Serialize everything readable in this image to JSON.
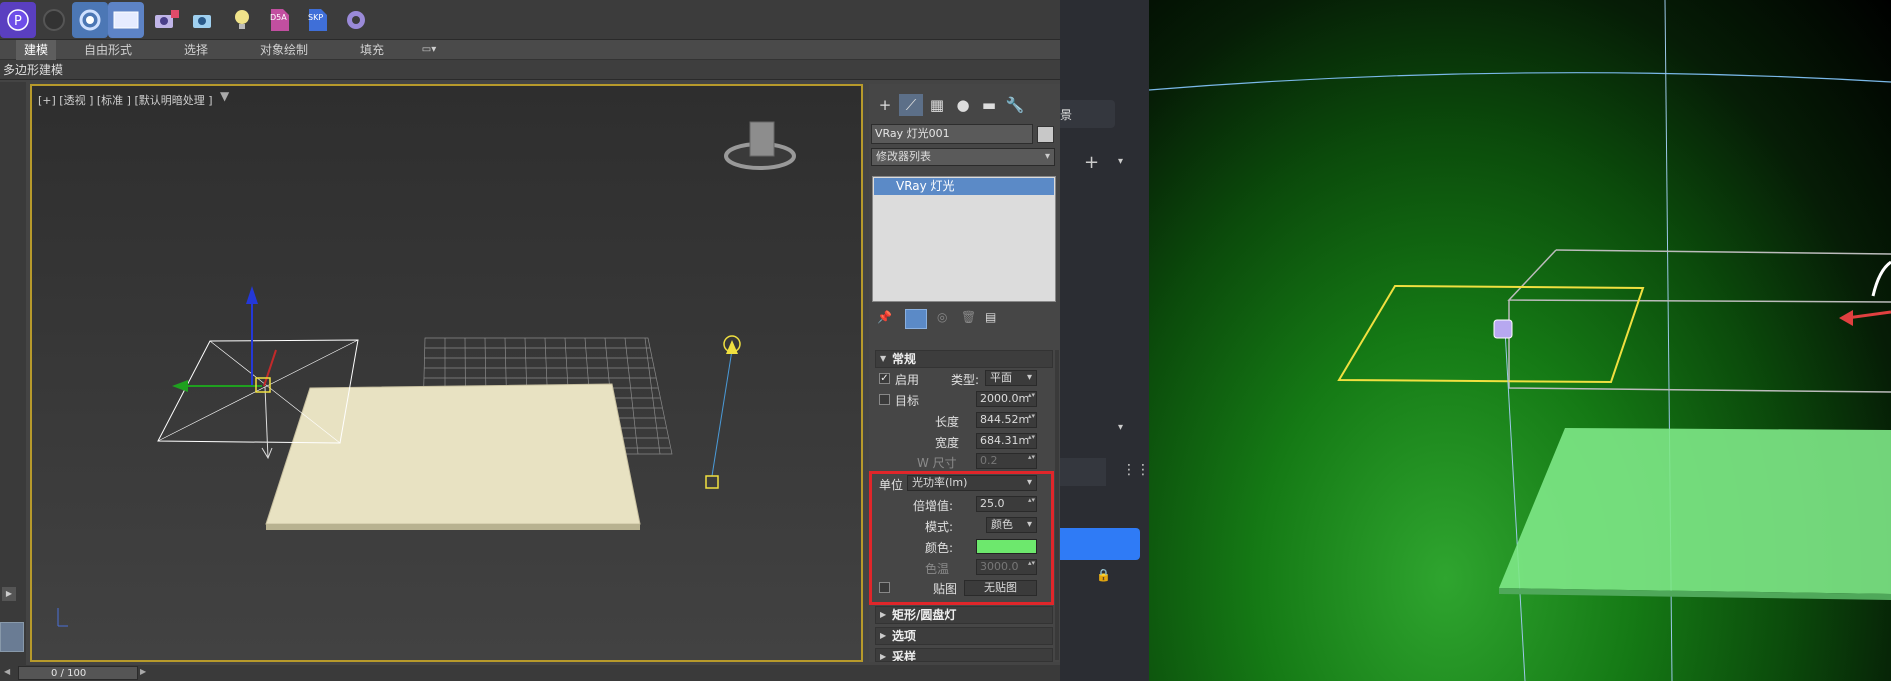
{
  "toolbar": {
    "icons": [
      "p-logo-icon",
      "dark-sphere-icon",
      "c-circle-icon",
      "render-window-icon",
      "camera-plus-icon",
      "camera-add-icon",
      "bulb-icon",
      "d5a-icon",
      "skp-icon",
      "gear-icon"
    ],
    "d5a_label": "D5A",
    "skp_label": "SKP"
  },
  "ribbon": {
    "tabs": [
      "建模",
      "自由形式",
      "选择",
      "对象绘制",
      "填充"
    ],
    "active_index": 0,
    "sub_label": "多边形建模"
  },
  "viewport": {
    "label": "[+] [透视 ] [标准 ] [默认明暗处理 ]",
    "border_color": "#b79a2b"
  },
  "timeline": {
    "frame": "0 / 100"
  },
  "panel": {
    "object_name": "VRay 灯光001",
    "modifier_list": "修改器列表",
    "stack_item": "VRay 灯光",
    "general": {
      "title": "常规",
      "enable_label": "启用",
      "enable_checked": true,
      "type_label": "类型:",
      "type_value": "平面",
      "target_label": "目标",
      "target_value": "2000.0m",
      "length_label": "长度",
      "length_value": "844.52m",
      "width_label": "宽度",
      "width_value": "684.31m",
      "size_label": "W 尺寸",
      "size_value": "0.2",
      "units_label": "单位",
      "units_value": "光功率(lm)",
      "multiplier_label": "倍增值:",
      "multiplier_value": "25.0",
      "mode_label": "模式:",
      "mode_value": "颜色",
      "color_label": "颜色:",
      "color_hex": "#6de86d",
      "temp_label": "色温",
      "temp_value": "3000.0",
      "map_label": "贴图",
      "map_value": "无贴图"
    },
    "rollouts": [
      "矩形/圆盘灯",
      "选项",
      "采样"
    ]
  },
  "right_app": {
    "gap_label": "景"
  },
  "colors": {
    "highlight_box": "#e0262a",
    "light_plane": "#e8e2c2"
  }
}
